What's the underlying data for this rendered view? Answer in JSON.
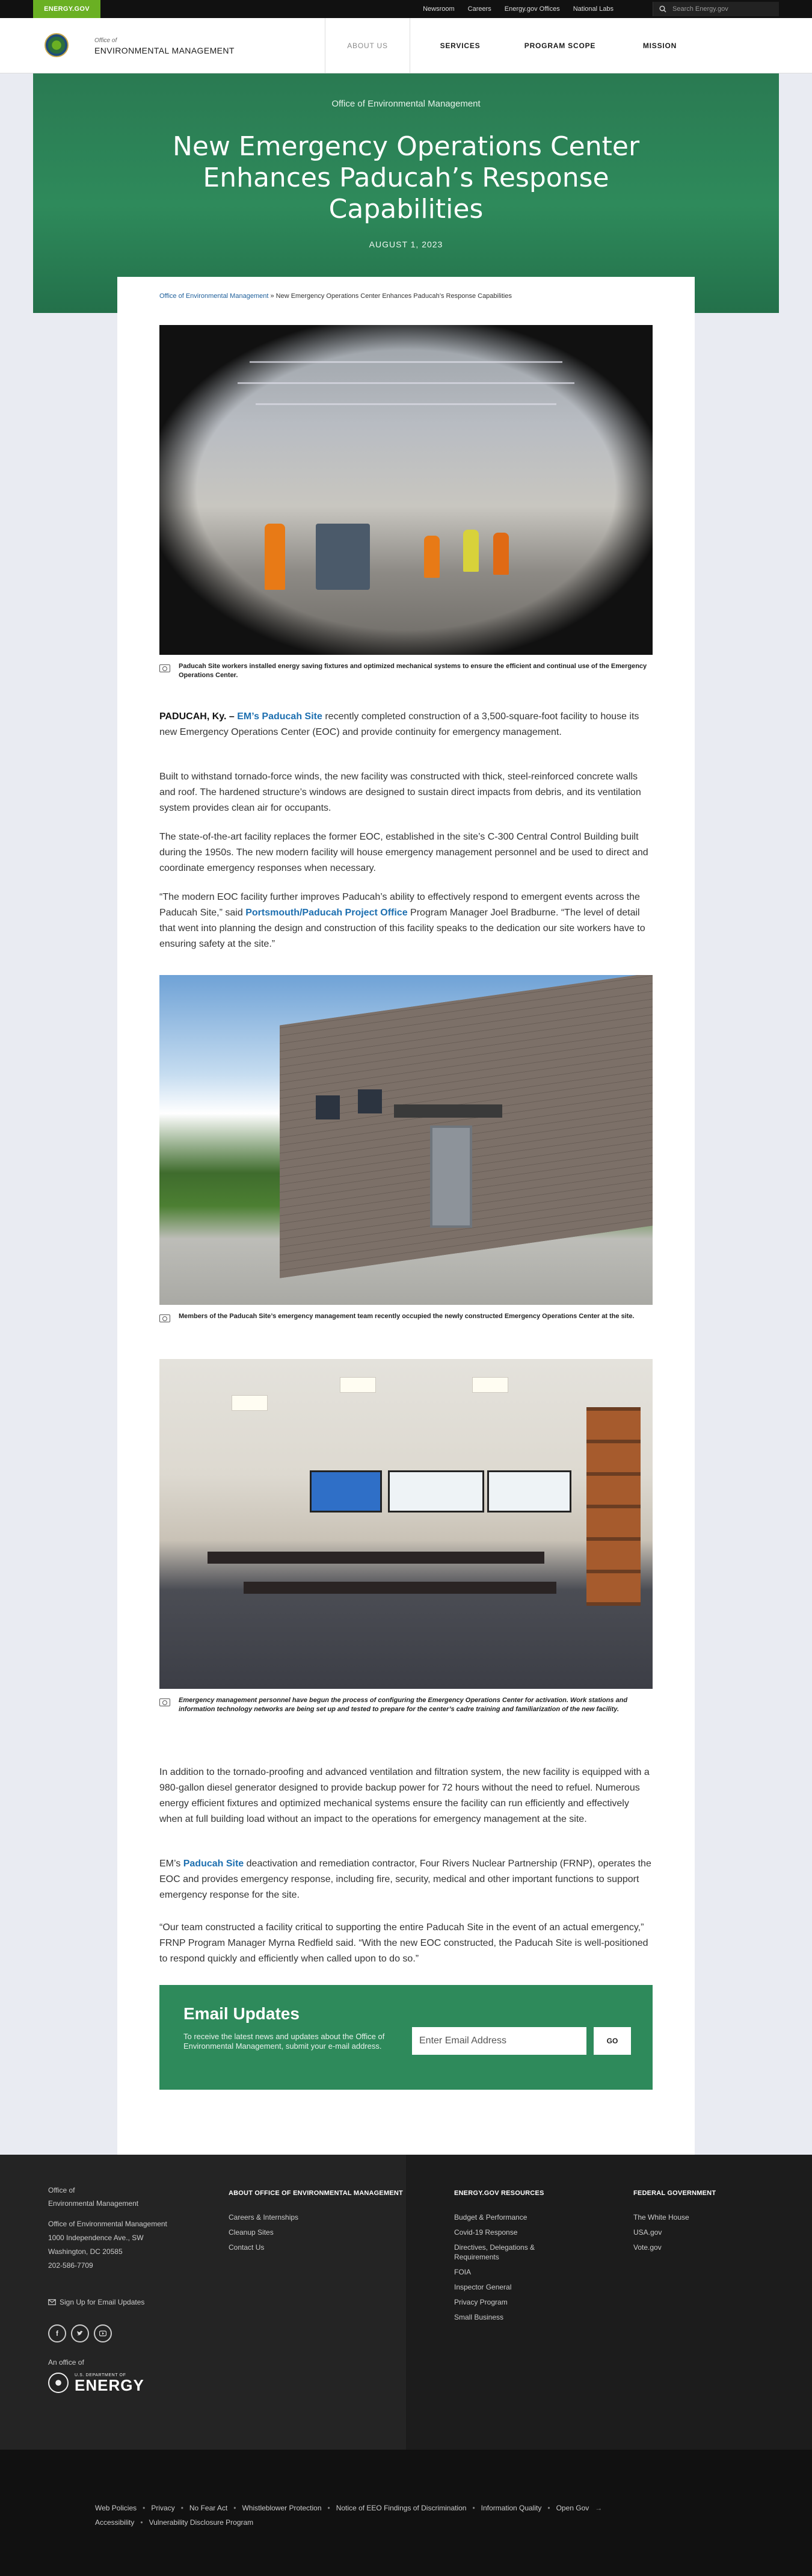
{
  "utility": {
    "brand": "ENERGY.GOV",
    "links": [
      "Newsroom",
      "Careers",
      "Energy.gov Offices",
      "National Labs"
    ],
    "search_placeholder": "Search Energy.gov"
  },
  "header": {
    "office_of": "Office of",
    "office_name": "ENVIRONMENTAL MANAGEMENT",
    "nav": [
      "ABOUT US",
      "SERVICES",
      "PROGRAM SCOPE",
      "MISSION"
    ]
  },
  "hero": {
    "subtitle": "Office of Environmental Management",
    "title": "New Emergency Operations Center Enhances Paducah’s Response Capabilities",
    "date": "AUGUST 1, 2023"
  },
  "breadcrumb": {
    "root": "Office of Environmental Management",
    "separator": " » ",
    "current": "New Emergency Operations Center Enhances Paducah’s Response Capabilities"
  },
  "captions": {
    "c1": "Paducah Site workers installed energy saving fixtures and optimized mechanical systems to ensure the efficient and continual use of the Emergency Operations Center.",
    "c2": "Members of the Paducah Site’s emergency management team recently occupied the newly constructed Emergency Operations Center at the site.",
    "c3": "Emergency management personnel have begun the process of configuring the Emergency Operations Center for activation. Work stations and information technology networks are being set up and tested to prepare for the center’s cadre training and familiarization of the new facility."
  },
  "article": {
    "p1_lead": "PADUCAH, Ky. –",
    "p1_link": "EM’s Paducah Site",
    "p1_rest": "recently completed construction of a 3,500-square-foot facility to house its new Emergency Operations Center (EOC) and provide continuity for emergency management.",
    "p2": "Built to withstand tornado-force winds, the new facility was constructed with thick, steel-reinforced concrete walls and roof. The hardened structure’s windows are designed to sustain direct impacts from debris, and its ventilation system provides clean air for occupants.",
    "p3": "The state-of-the-art facility replaces the former EOC, established in the site’s C-300 Central Control Building built during the 1950s. The new modern facility will house emergency management personnel and be used to direct and coordinate emergency responses when necessary.",
    "p4_a": "“The modern EOC facility further improves Paducah’s ability to effectively respond to emergent events across the Paducah Site,” said",
    "p4_link": "Portsmouth/Paducah Project Office",
    "p4_b": "Program Manager Joel Bradburne. “The level of detail that went into planning the design and construction of this facility speaks to the dedication our site workers have to ensuring safety at the site.”",
    "p5": "In addition to the tornado-proofing and advanced ventilation and filtration system, the new facility is equipped with a 980-gallon diesel generator designed to provide backup power for 72 hours without the need to refuel. Numerous energy efficient fixtures and optimized mechanical systems ensure the facility can run efficiently and effectively when at full building load without an impact to the operations for emergency management at the site.",
    "p6_a": "EM’s",
    "p6_link": "Paducah Site",
    "p6_b": "deactivation and remediation contractor, Four Rivers Nuclear Partnership (FRNP), operates the EOC and provides emergency response, including fire, security, medical and other important functions to support emergency response for the site.",
    "p7": "“Our team constructed a facility critical to supporting the entire Paducah Site in the event of an actual emergency,” FRNP Program Manager Myrna Redfield said. “With the new EOC constructed, the Paducah Site is well-positioned to respond quickly and efficiently when called upon to do so.”"
  },
  "email": {
    "title": "Email Updates",
    "description": "To receive the latest news and updates about the Office of Environmental Management, submit your e-mail address.",
    "placeholder": "Enter Email Address",
    "button": "GO"
  },
  "footer": {
    "office_of_line1": "Office of",
    "office_of_line2": "Environmental Management",
    "address": [
      "Office of Environmental Management",
      "1000 Independence Ave., SW",
      "Washington, DC 20585",
      "202-586-7709"
    ],
    "signup": "Sign Up for Email Updates",
    "an_office_of": "An office of",
    "doe_small": "U.S. DEPARTMENT OF",
    "doe_big": "ENERGY",
    "columns": [
      {
        "heading": "ABOUT OFFICE OF ENVIRONMENTAL MANAGEMENT",
        "links": [
          "Careers & Internships",
          "Cleanup Sites",
          "Contact Us"
        ]
      },
      {
        "heading": "ENERGY.GOV RESOURCES",
        "links": [
          "Budget & Performance",
          "Covid-19 Response",
          "Directives, Delegations & Requirements",
          "FOIA",
          "Inspector General",
          "Privacy Program",
          "Small Business"
        ]
      },
      {
        "heading": "FEDERAL GOVERNMENT",
        "links": [
          "The White House",
          "USA.gov",
          "Vote.gov"
        ]
      }
    ],
    "bottom_links_row1": [
      "Web Policies",
      "Privacy",
      "No Fear Act",
      "Whistleblower Protection",
      "Notice of EEO Findings of Discrimination",
      "Information Quality",
      "Open Gov"
    ],
    "bottom_links_row2": [
      "Accessibility",
      "Vulnerability Disclosure Program"
    ]
  },
  "colors": {
    "brand_green": "#6ab023",
    "hero_green": "#2e8a5b",
    "link_blue": "#1d6fb0",
    "footer_dark": "#242424"
  }
}
